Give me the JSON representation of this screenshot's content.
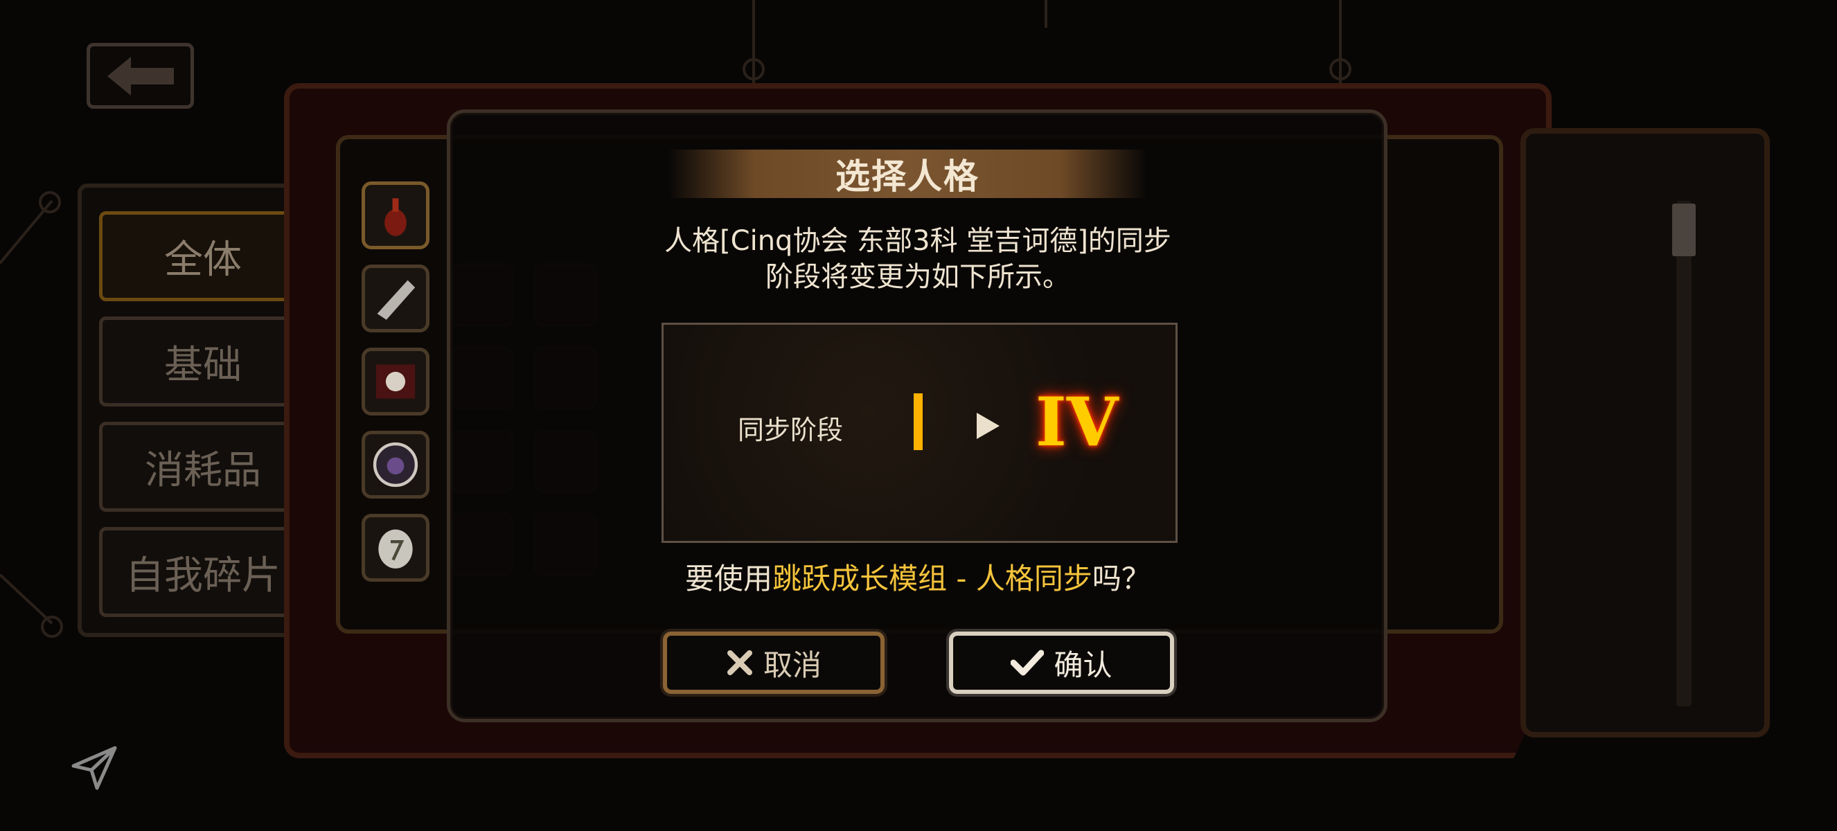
{
  "categories": [
    "全体",
    "基础",
    "消耗品",
    "自我碎片"
  ],
  "modal": {
    "title": "选择人格",
    "description_line1": "人格[Cinq协会 东部3科 堂吉诃德]的同步",
    "description_line2": "阶段将变更为如下所示。",
    "sync_label": "同步阶段",
    "from_stage": "I",
    "to_stage": "IV",
    "question_prefix": "要使用",
    "question_item": "跳跃成长模组 - 人格同步",
    "question_suffix": "吗？",
    "cancel_label": "取消",
    "confirm_label": "确认"
  },
  "icons": {
    "back": "back-arrow-icon",
    "cancel": "x-icon",
    "confirm": "check-icon",
    "share": "share-icon"
  },
  "colors": {
    "accent_gold": "#f5c43b",
    "stage_glow": "#ff3300",
    "frame_red": "#3b1a10"
  }
}
